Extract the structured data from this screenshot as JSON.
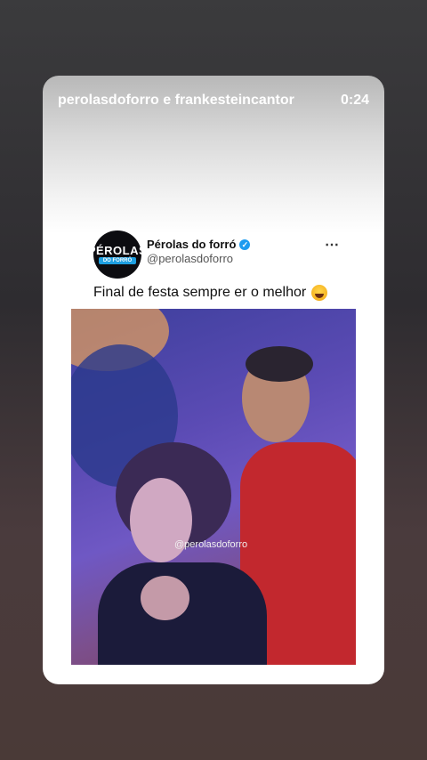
{
  "story": {
    "accounts": "perolasdoforro e frankesteincantor",
    "time": "0:24"
  },
  "tweet": {
    "avatar_text_top": "PÉROLAS",
    "avatar_text_bottom": "DO FORRÓ",
    "display_name": "Pérolas do forró",
    "handle": "@perolasdoforro",
    "more_icon": "⋯",
    "text": "Final de festa sempre er o melhor",
    "emoji": "laughing-with-tears-emoji"
  },
  "video": {
    "watermark": "@perolasdoforro"
  },
  "colors": {
    "verified": "#1d9bf0",
    "shirt_red": "#c2282e"
  }
}
